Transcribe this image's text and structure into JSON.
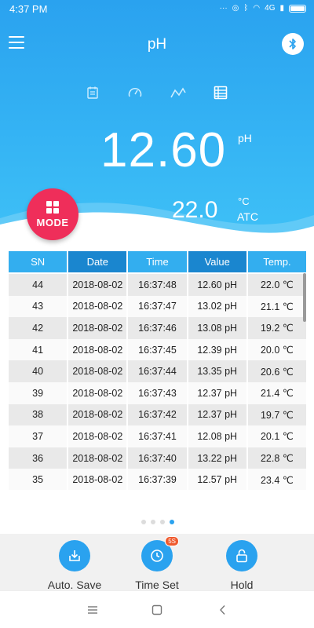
{
  "status_bar": {
    "time": "4:37 PM",
    "signal_label": "4G"
  },
  "app": {
    "title": "pH"
  },
  "reading": {
    "value": "12.60",
    "unit": "pH"
  },
  "temperature": {
    "value": "22.0",
    "unit": "°C",
    "mode": "ATC"
  },
  "mode_button": {
    "label": "MODE"
  },
  "table": {
    "headers": [
      "SN",
      "Date",
      "Time",
      "Value",
      "Temp."
    ],
    "rows": [
      [
        "44",
        "2018-08-02",
        "16:37:48",
        "12.60 pH",
        "22.0 ℃"
      ],
      [
        "43",
        "2018-08-02",
        "16:37:47",
        "13.02 pH",
        "21.1 ℃"
      ],
      [
        "42",
        "2018-08-02",
        "16:37:46",
        "13.08 pH",
        "19.2 ℃"
      ],
      [
        "41",
        "2018-08-02",
        "16:37:45",
        "12.39 pH",
        "20.0 ℃"
      ],
      [
        "40",
        "2018-08-02",
        "16:37:44",
        "13.35 pH",
        "20.6 ℃"
      ],
      [
        "39",
        "2018-08-02",
        "16:37:43",
        "12.37 pH",
        "21.4 ℃"
      ],
      [
        "38",
        "2018-08-02",
        "16:37:42",
        "12.37 pH",
        "19.7 ℃"
      ],
      [
        "37",
        "2018-08-02",
        "16:37:41",
        "12.08 pH",
        "20.1 ℃"
      ],
      [
        "36",
        "2018-08-02",
        "16:37:40",
        "13.22 pH",
        "22.8 ℃"
      ],
      [
        "35",
        "2018-08-02",
        "16:37:39",
        "12.57 pH",
        "23.4 ℃"
      ]
    ]
  },
  "pager": {
    "count": 4,
    "active": 3
  },
  "actions": {
    "auto_save": {
      "label": "Auto. Save"
    },
    "time_set": {
      "label": "Time Set",
      "badge": "5S"
    },
    "hold": {
      "label": "Hold"
    }
  },
  "colors": {
    "primary": "#2aa2ef",
    "accent": "#ef2e5a",
    "header_dark": "#1a86cf"
  }
}
